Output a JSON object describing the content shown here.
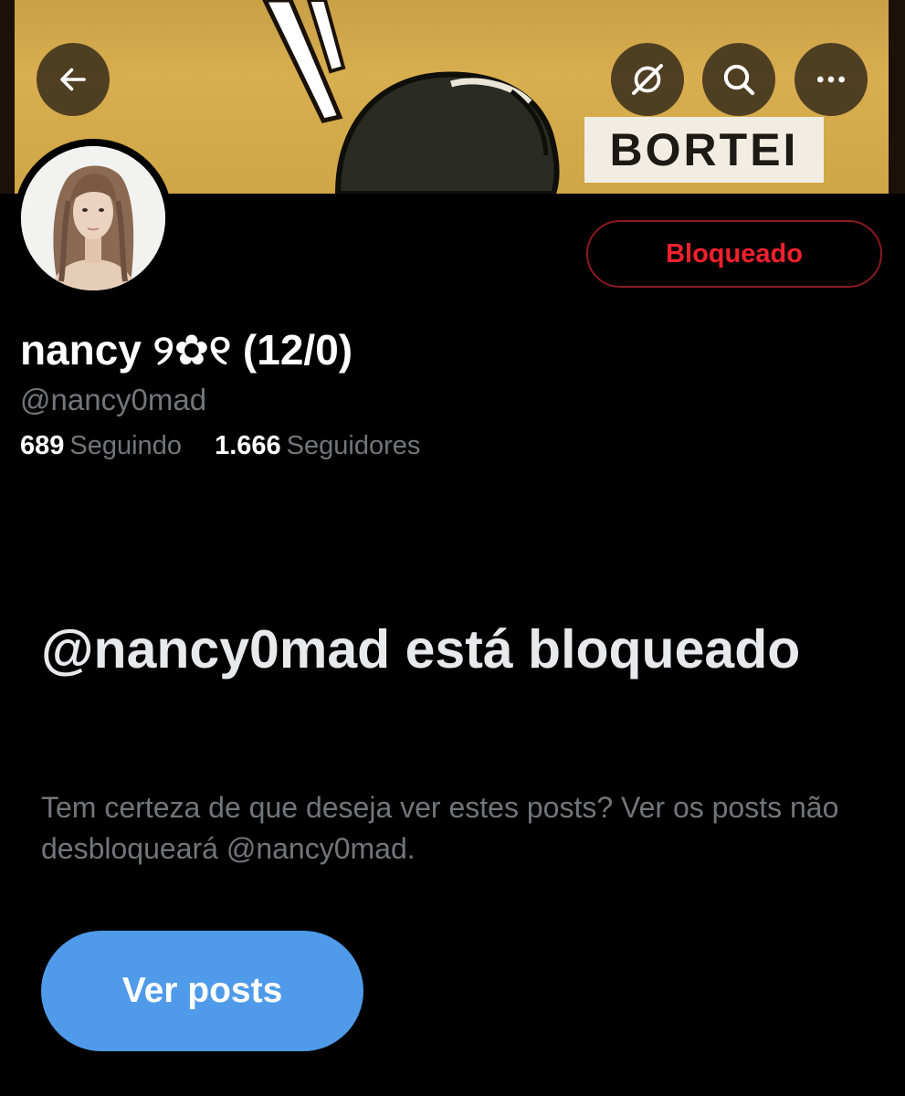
{
  "header": {
    "banner_text": "BORTEI",
    "back_icon": "arrow-left-icon",
    "grok_icon": "grok-icon",
    "search_icon": "search-icon",
    "more_icon": "more-horizontal-icon"
  },
  "profile": {
    "display_name": "nancy ୨✿୧ (12/0)",
    "handle": "@nancy0mad",
    "following_count": "689",
    "following_label": "Seguindo",
    "followers_count": "1.666",
    "followers_label": "Seguidores",
    "blocked_button_label": "Bloqueado"
  },
  "blocked_notice": {
    "title": "@nancy0mad está bloqueado",
    "description": "Tem certeza de que deseja ver estes posts? Ver os posts não desbloqueará @nancy0mad.",
    "view_button_label": "Ver posts"
  },
  "colors": {
    "background": "#000000",
    "blocked_red": "#f4212e",
    "primary_blue": "#4f9be9",
    "secondary_text": "#71767b"
  }
}
